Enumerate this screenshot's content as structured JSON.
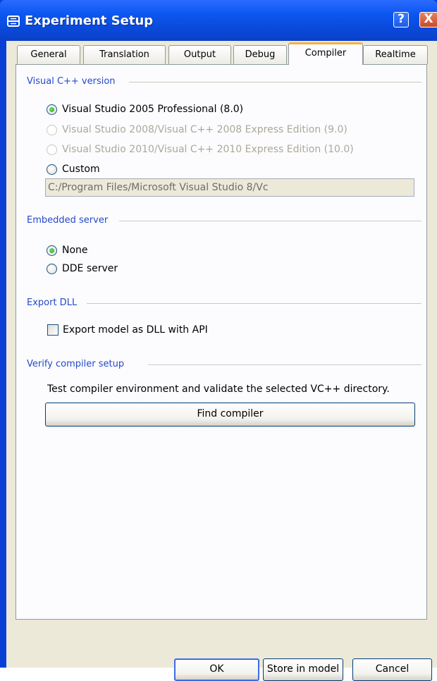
{
  "window": {
    "title": "Experiment Setup",
    "help_label": "?",
    "close_label": "X"
  },
  "tabs": [
    {
      "label": "General",
      "active": false
    },
    {
      "label": "Translation",
      "active": false
    },
    {
      "label": "Output",
      "active": false
    },
    {
      "label": "Debug",
      "active": false
    },
    {
      "label": "Compiler",
      "active": true
    },
    {
      "label": "Realtime",
      "active": false
    }
  ],
  "vc_version": {
    "heading": "Visual C++ version",
    "options": [
      {
        "label": "Visual Studio 2005 Professional (8.0)",
        "selected": true,
        "enabled": true
      },
      {
        "label": "Visual Studio 2008/Visual C++ 2008 Express Edition (9.0)",
        "selected": false,
        "enabled": false
      },
      {
        "label": "Visual Studio 2010/Visual C++ 2010 Express Edition (10.0)",
        "selected": false,
        "enabled": false
      },
      {
        "label": "Custom",
        "selected": false,
        "enabled": true
      }
    ],
    "custom_path": "C:/Program Files/Microsoft Visual Studio 8/Vc"
  },
  "embedded_server": {
    "heading": "Embedded server",
    "options": [
      {
        "label": "None",
        "selected": true
      },
      {
        "label": "DDE server",
        "selected": false
      }
    ]
  },
  "export_dll": {
    "heading": "Export DLL",
    "checkbox_label": "Export model as DLL with API",
    "checked": false
  },
  "verify": {
    "heading": "Verify compiler setup",
    "description": "Test compiler environment and validate the selected VC++ directory.",
    "button_label": "Find compiler"
  },
  "footer": {
    "ok_label": "OK",
    "store_label": "Store in model",
    "cancel_label": "Cancel"
  },
  "colors": {
    "title_bar": "#0a49da",
    "section_heading": "#2548c8",
    "active_tab_accent": "#f7b13b",
    "radio_selected": "#21a121"
  }
}
